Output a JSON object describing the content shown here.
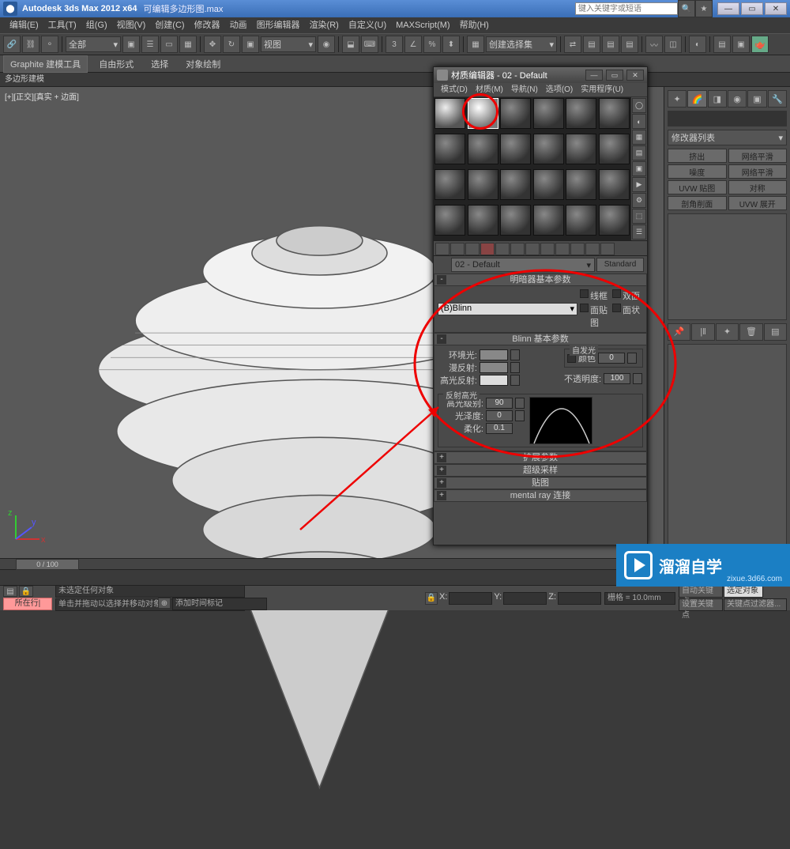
{
  "titlebar": {
    "app": "Autodesk 3ds Max 2012 x64",
    "file": "可编辑多边形图.max",
    "search_ph": "键入关键字或短语"
  },
  "menu": [
    "编辑(E)",
    "工具(T)",
    "组(G)",
    "视图(V)",
    "创建(C)",
    "修改器",
    "动画",
    "图形编辑器",
    "渲染(R)",
    "自定义(U)",
    "MAXScript(M)",
    "帮助(H)"
  ],
  "ribbon": {
    "tabs": [
      "Graphite 建模工具",
      "自由形式",
      "选择",
      "对象绘制"
    ],
    "sub": "多边形建模"
  },
  "viewport": {
    "label": "[+][正交][真实 + 边面]"
  },
  "cmdpanel": {
    "dd": "修改器列表",
    "buttons": [
      "挤出",
      "网络平滑",
      "噪度",
      "网络平滑",
      "UVW 贴图",
      "对称",
      "剖角削面",
      "UVW 展开"
    ]
  },
  "matwin": {
    "title": "材质编辑器 - 02 - Default",
    "menu": [
      "模式(D)",
      "材质(M)",
      "导航(N)",
      "选项(O)",
      "实用程序(U)"
    ],
    "name": "02 - Default",
    "type": "Standard",
    "roll1": {
      "title": "明暗器基本参数",
      "shader": "(B)Blinn",
      "opts": [
        "线框",
        "双面",
        "面贴图",
        "面状"
      ]
    },
    "roll2": {
      "title": "Blinn 基本参数",
      "ambient": "环境光:",
      "diffuse": "漫反射:",
      "specular": "高光反射:",
      "selfillum": "自发光",
      "color": "颜色",
      "color_val": "0",
      "opacity": "不透明度:",
      "opacity_val": "100",
      "spec_group": "反射高光",
      "spec_level": "高光级别:",
      "spec_level_val": "90",
      "gloss": "光泽度:",
      "gloss_val": "0",
      "soften": "柔化:",
      "soften_val": "0.1"
    },
    "rolls": [
      "扩展参数",
      "超级采样",
      "贴图",
      "mental ray 连接"
    ]
  },
  "timeline": {
    "slider": "0 / 100"
  },
  "status": {
    "sel_set": "所在行|",
    "none": "未选定任何对象",
    "hint": "单击并拖动以选择并移动对象",
    "x": "X:",
    "y": "Y:",
    "z": "Z:",
    "grid": "栅格 = 10.0mm",
    "autokey": "自动关键点",
    "selset": "选定对象",
    "addtime": "添加时间标记",
    "setkey": "设置关键点",
    "keyfilter": "关键点过滤器..."
  },
  "toolbar_dd": [
    "全部",
    "视图",
    "创建选择集"
  ],
  "watermark": {
    "title": "溜溜自学",
    "url": "zixue.3d66.com"
  }
}
